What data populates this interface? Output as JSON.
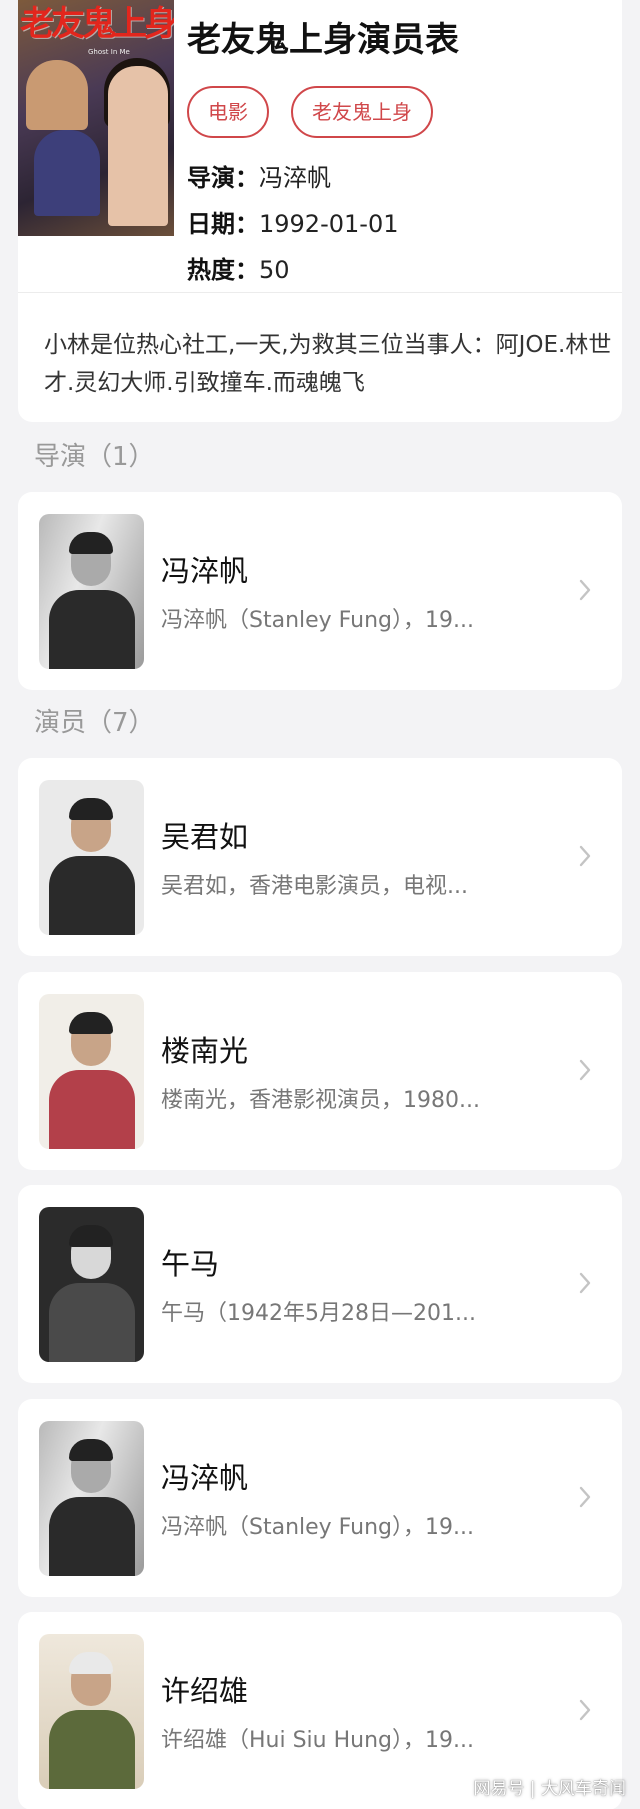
{
  "movie": {
    "title": "老友鬼上身演员表",
    "poster_title": "老友鬼上身",
    "poster_subtitle": "Ghost In Me",
    "tags": [
      "电影",
      "老友鬼上身"
    ],
    "director_label": "导演：",
    "director_value": "冯淬帆",
    "date_label": "日期：",
    "date_value": "1992-01-01",
    "heat_label": "热度：",
    "heat_value": "50",
    "synopsis": "小林是位热心社工,一天,为救其三位当事人：阿JOE.林世才.灵幻大师.引致撞车.而魂魄飞"
  },
  "sections": {
    "directors": "导演（1）",
    "actors": "演员（7）"
  },
  "directors": [
    {
      "name": "冯淬帆",
      "desc": "冯淬帆（Stanley Fung），19..."
    }
  ],
  "actors": [
    {
      "name": "吴君如",
      "desc": "吴君如，香港电影演员，电视..."
    },
    {
      "name": "楼南光",
      "desc": "楼南光，香港影视演员，1980..."
    },
    {
      "name": "午马",
      "desc": "午马（1942年5月28日—201..."
    },
    {
      "name": "冯淬帆",
      "desc": "冯淬帆（Stanley Fung），19..."
    },
    {
      "name": "许绍雄",
      "desc": "许绍雄（Hui Siu Hung），19..."
    }
  ],
  "watermark": "网易号 | 大风车奇闻",
  "colors": {
    "accent": "#d0474a",
    "background": "#f3f3f5",
    "card": "#ffffff",
    "muted": "#999999"
  },
  "icons": {
    "chevron": "chevron-right-icon"
  }
}
